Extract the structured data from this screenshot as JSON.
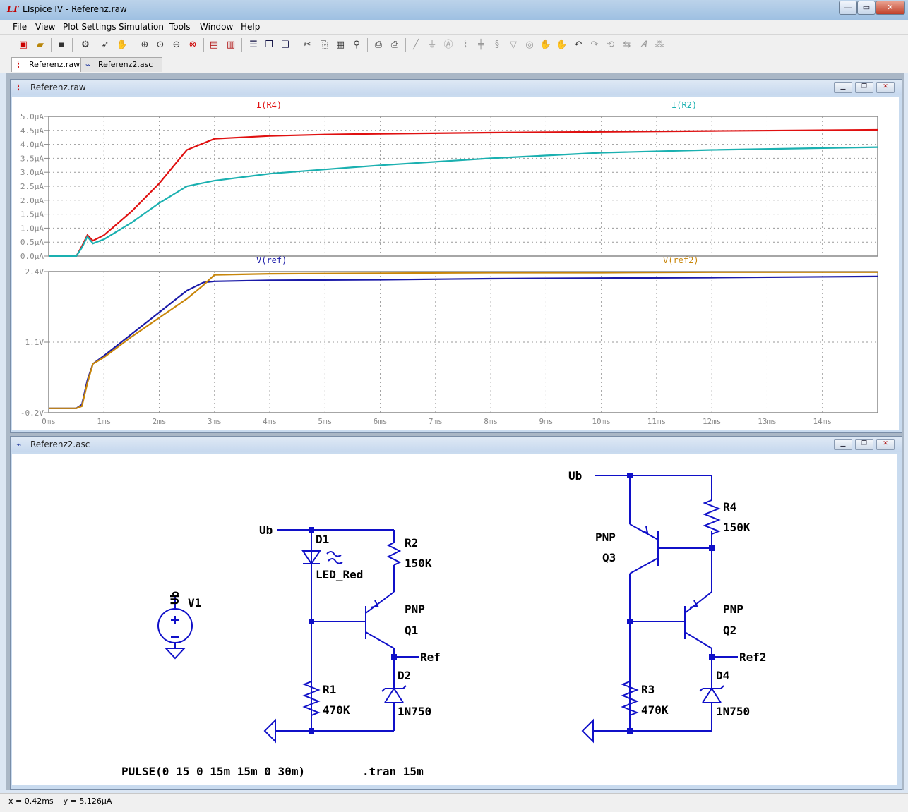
{
  "window": {
    "title": "LTspice IV - Referenz.raw",
    "min": "—",
    "max": "▭",
    "close": "✕"
  },
  "menu": [
    "File",
    "View",
    "Plot Settings",
    "Simulation",
    "Tools",
    "Window",
    "Help"
  ],
  "tabs": [
    {
      "label": "Referenz.raw",
      "active": true
    },
    {
      "label": "Referenz2.asc",
      "active": false
    }
  ],
  "plot_window": {
    "title": "Referenz.raw",
    "top_pane": {
      "traces": [
        {
          "label": "I(R4)",
          "color": "#e01010"
        },
        {
          "label": "I(R2)",
          "color": "#1ab0b0"
        }
      ],
      "y_ticks": [
        "5.0µA",
        "4.5µA",
        "4.0µA",
        "3.5µA",
        "3.0µA",
        "2.5µA",
        "2.0µA",
        "1.5µA",
        "1.0µA",
        "0.5µA",
        "0.0µA"
      ]
    },
    "bottom_pane": {
      "traces": [
        {
          "label": "V(ref)",
          "color": "#1a1aa8"
        },
        {
          "label": "V(ref2)",
          "color": "#c8860a"
        }
      ],
      "y_ticks": [
        "2.4V",
        "1.1V",
        "-0.2V"
      ]
    },
    "x_ticks": [
      "0ms",
      "1ms",
      "2ms",
      "3ms",
      "4ms",
      "5ms",
      "6ms",
      "7ms",
      "8ms",
      "9ms",
      "10ms",
      "11ms",
      "12ms",
      "13ms",
      "14ms"
    ]
  },
  "chart_data": [
    {
      "type": "line",
      "xlabel": "",
      "ylabel": "",
      "xlim": [
        0,
        15
      ],
      "ylim": [
        0,
        5.0
      ],
      "grid": true,
      "series": [
        {
          "name": "I(R4)",
          "x": [
            0,
            0.5,
            0.6,
            0.7,
            0.8,
            1,
            1.5,
            2,
            2.5,
            3,
            4,
            5,
            6,
            8,
            10,
            12,
            15
          ],
          "y": [
            0,
            0,
            0.35,
            0.75,
            0.55,
            0.75,
            1.6,
            2.6,
            3.8,
            4.2,
            4.3,
            4.35,
            4.38,
            4.42,
            4.45,
            4.48,
            4.52
          ]
        },
        {
          "name": "I(R2)",
          "x": [
            0,
            0.5,
            0.6,
            0.7,
            0.8,
            1,
            1.5,
            2,
            2.5,
            3,
            4,
            5,
            6,
            8,
            10,
            12,
            15
          ],
          "y": [
            0,
            0,
            0.3,
            0.7,
            0.45,
            0.6,
            1.2,
            1.9,
            2.5,
            2.7,
            2.95,
            3.1,
            3.25,
            3.5,
            3.7,
            3.8,
            3.9
          ]
        }
      ]
    },
    {
      "type": "line",
      "xlabel": "",
      "ylabel": "",
      "xlim": [
        0,
        15
      ],
      "ylim": [
        -0.2,
        2.4
      ],
      "grid": true,
      "series": [
        {
          "name": "V(ref)",
          "x": [
            0,
            0.5,
            0.6,
            0.7,
            0.8,
            1,
            1.5,
            2,
            2.5,
            2.8,
            3,
            4,
            6,
            8,
            10,
            12,
            15
          ],
          "y": [
            -0.12,
            -0.12,
            -0.05,
            0.4,
            0.7,
            0.85,
            1.25,
            1.65,
            2.05,
            2.2,
            2.22,
            2.24,
            2.25,
            2.27,
            2.28,
            2.29,
            2.31
          ]
        },
        {
          "name": "V(ref2)",
          "x": [
            0,
            0.5,
            0.6,
            0.7,
            0.8,
            1,
            1.5,
            2,
            2.5,
            2.8,
            3,
            4,
            6,
            8,
            10,
            12,
            15
          ],
          "y": [
            -0.12,
            -0.12,
            -0.08,
            0.35,
            0.7,
            0.82,
            1.2,
            1.55,
            1.9,
            2.15,
            2.34,
            2.36,
            2.37,
            2.38,
            2.38,
            2.39,
            2.39
          ]
        }
      ]
    }
  ],
  "schematic_window": {
    "title": "Referenz2.asc",
    "labels": {
      "ub1": "Ub",
      "d1": "D1",
      "led": "LED_Red",
      "r2": "R2",
      "r2v": "150K",
      "pnp1": "PNP",
      "q1": "Q1",
      "ref": "Ref",
      "d2": "D2",
      "d2v": "1N750",
      "r1": "R1",
      "r1v": "470K",
      "v1": "V1",
      "v1net": "Ub",
      "ub2": "Ub",
      "r4": "R4",
      "r4v": "150K",
      "pnp3": "PNP",
      "q3": "Q3",
      "pnp2": "PNP",
      "q2": "Q2",
      "ref2": "Ref2",
      "d4": "D4",
      "d4v": "1N750",
      "r3": "R3",
      "r3v": "470K",
      "pulse": "PULSE(0 15 0 15m 15m 0 30m)",
      "tran": ".tran 15m"
    }
  },
  "status": {
    "text": "x = 0.42ms    y = 5.126µA"
  }
}
